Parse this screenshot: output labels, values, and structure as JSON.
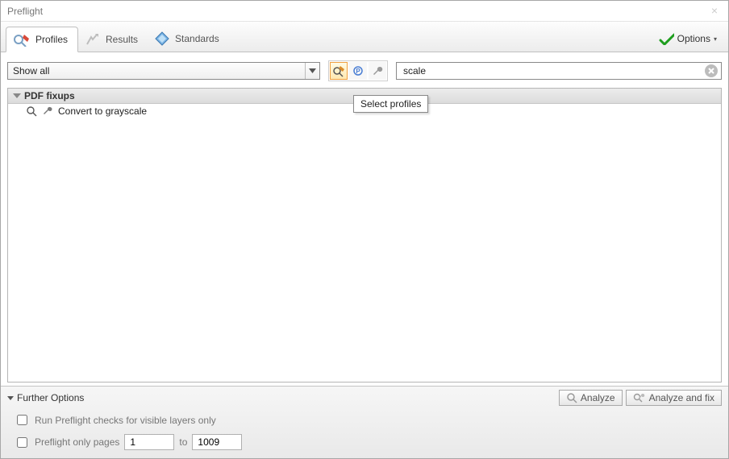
{
  "window": {
    "title": "Preflight"
  },
  "tabs": {
    "profiles": "Profiles",
    "results": "Results",
    "standards": "Standards"
  },
  "options_label": "Options",
  "filter": {
    "selected": "Show all"
  },
  "search": {
    "value": "scale"
  },
  "tooltip": "Select profiles",
  "list": {
    "group_title": "PDF fixups",
    "rows": [
      {
        "label": "Convert to grayscale"
      }
    ]
  },
  "footer": {
    "heading": "Further Options",
    "analyze": "Analyze",
    "analyze_fix": "Analyze and fix",
    "check_layers": "Run Preflight checks for visible layers only",
    "check_pages": "Preflight only pages",
    "page_from": "1",
    "page_to_label": "to",
    "page_to": "1009"
  }
}
